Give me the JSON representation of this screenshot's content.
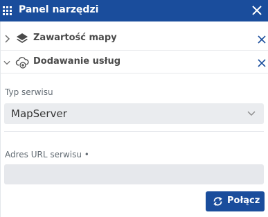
{
  "header": {
    "title": "Panel narzędzi"
  },
  "sections": [
    {
      "label": "Zawartość mapy",
      "icon": "layers-icon",
      "state": "collapsed"
    },
    {
      "label": "Dodawanie usług",
      "icon": "cloud-add-icon",
      "state": "expanded"
    }
  ],
  "form": {
    "service_type_label": "Typ serwisu",
    "service_type_value": "MapServer",
    "url_label": "Adres URL serwisu •",
    "url_value": "",
    "url_placeholder": "",
    "connect_label": "Połącz"
  },
  "colors": {
    "accent": "#1a4d9c",
    "close_x": "#1a4d9c",
    "field_bg": "#eaecef"
  }
}
